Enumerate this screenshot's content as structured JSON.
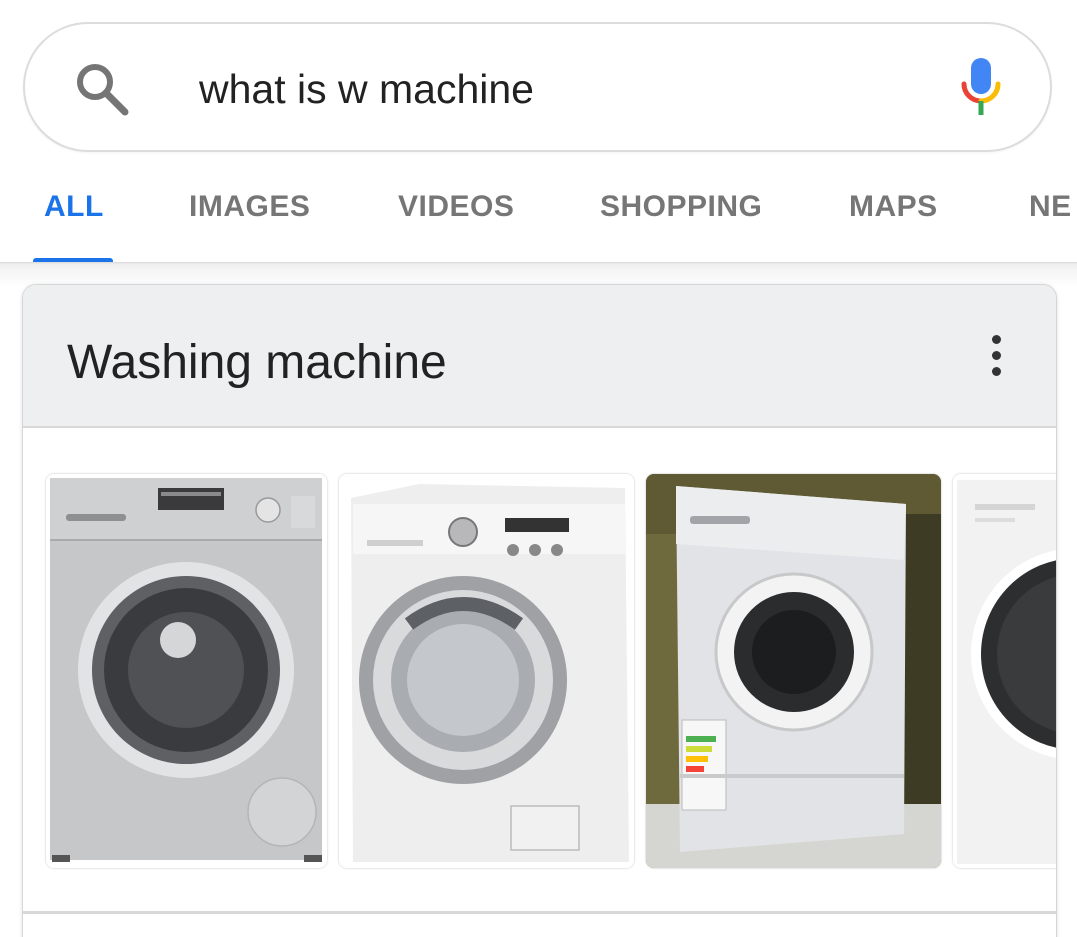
{
  "search": {
    "query": "what is w machine"
  },
  "tabs": [
    {
      "label": "ALL",
      "active": true
    },
    {
      "label": "IMAGES",
      "active": false
    },
    {
      "label": "VIDEOS",
      "active": false
    },
    {
      "label": "SHOPPING",
      "active": false
    },
    {
      "label": "MAPS",
      "active": false
    },
    {
      "label": "NE",
      "active": false
    }
  ],
  "knowledge_card": {
    "title": "Washing machine",
    "images": [
      {
        "icon": "washing-machine-silver"
      },
      {
        "icon": "washing-machine-white-chrome"
      },
      {
        "icon": "washing-machine-white-photo"
      },
      {
        "icon": "washing-machine-white-dark-door"
      }
    ]
  },
  "colors": {
    "accent": "#1a73e8",
    "tab_inactive": "#767676",
    "mic_blue": "#4285f4",
    "mic_red": "#ea4335",
    "mic_yellow": "#fbbc05",
    "mic_green": "#34a853"
  }
}
